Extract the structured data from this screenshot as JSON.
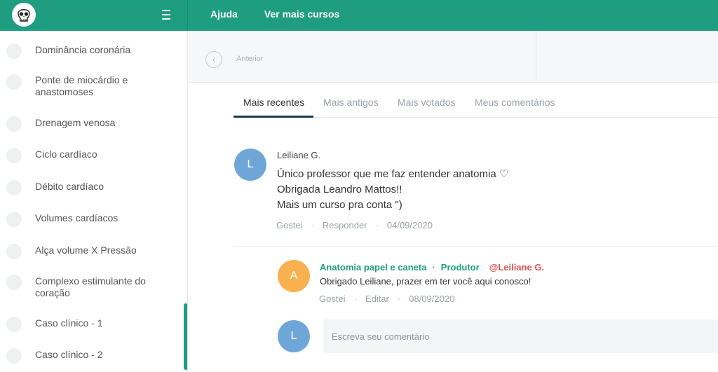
{
  "topnav": {
    "items": [
      "Ajuda",
      "Ver mais cursos"
    ]
  },
  "sidebar": {
    "lessons": [
      "Dominância coronária",
      "Ponte de miocárdio e anastomoses",
      "Drenagem venosa",
      "Ciclo cardíaco",
      "Débito cardíaco",
      "Volumes cardíacos",
      "Alça volume X Pressão",
      "Complexo estimulante do coração",
      "Caso clínico - 1",
      "Caso clínico - 2"
    ]
  },
  "lesson_nav": {
    "prev_label": "Anterior"
  },
  "tabs": [
    "Mais recentes",
    "Mais antigos",
    "Mais votados",
    "Meus comentários"
  ],
  "comment": {
    "avatar_letter": "L",
    "author": "Leiliane G.",
    "lines": [
      "Único professor que me faz entender anatomia ♡",
      "Obrigada Leandro Mattos!!",
      "Mais um curso pra conta \")"
    ],
    "actions": {
      "like": "Gostei",
      "reply": "Responder",
      "date": "04/09/2020"
    }
  },
  "reply": {
    "avatar_letter": "A",
    "author": "Anatomia papel e caneta",
    "separator": "·",
    "role": "Produtor",
    "mention": "@Leiliane G.",
    "body": "Obrigado Leiliane, prazer em ter você aqui conosco!",
    "actions": {
      "like": "Gostei",
      "edit": "Editar",
      "date": "08/09/2020"
    }
  },
  "new_comment": {
    "avatar_letter": "L",
    "placeholder": "Escreva seu comentário"
  },
  "colors": {
    "brand": "#1f9d80",
    "mention": "#e05555",
    "avatar_blue": "#6fa6d8",
    "avatar_orange": "#f9b14f"
  }
}
